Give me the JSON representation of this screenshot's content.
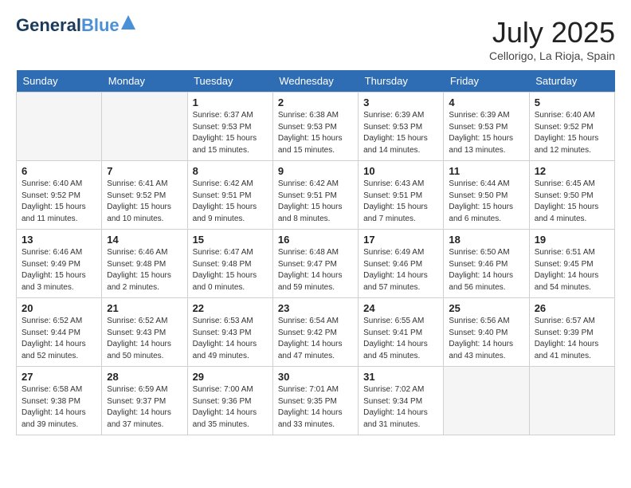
{
  "header": {
    "logo_line1": "General",
    "logo_line2": "Blue",
    "month_title": "July 2025",
    "location": "Cellorigo, La Rioja, Spain"
  },
  "weekdays": [
    "Sunday",
    "Monday",
    "Tuesday",
    "Wednesday",
    "Thursday",
    "Friday",
    "Saturday"
  ],
  "weeks": [
    [
      {
        "day": "",
        "empty": true
      },
      {
        "day": "",
        "empty": true
      },
      {
        "day": "1",
        "sunrise": "6:37 AM",
        "sunset": "9:53 PM",
        "daylight": "15 hours and 15 minutes."
      },
      {
        "day": "2",
        "sunrise": "6:38 AM",
        "sunset": "9:53 PM",
        "daylight": "15 hours and 15 minutes."
      },
      {
        "day": "3",
        "sunrise": "6:39 AM",
        "sunset": "9:53 PM",
        "daylight": "15 hours and 14 minutes."
      },
      {
        "day": "4",
        "sunrise": "6:39 AM",
        "sunset": "9:53 PM",
        "daylight": "15 hours and 13 minutes."
      },
      {
        "day": "5",
        "sunrise": "6:40 AM",
        "sunset": "9:52 PM",
        "daylight": "15 hours and 12 minutes."
      }
    ],
    [
      {
        "day": "6",
        "sunrise": "6:40 AM",
        "sunset": "9:52 PM",
        "daylight": "15 hours and 11 minutes."
      },
      {
        "day": "7",
        "sunrise": "6:41 AM",
        "sunset": "9:52 PM",
        "daylight": "15 hours and 10 minutes."
      },
      {
        "day": "8",
        "sunrise": "6:42 AM",
        "sunset": "9:51 PM",
        "daylight": "15 hours and 9 minutes."
      },
      {
        "day": "9",
        "sunrise": "6:42 AM",
        "sunset": "9:51 PM",
        "daylight": "15 hours and 8 minutes."
      },
      {
        "day": "10",
        "sunrise": "6:43 AM",
        "sunset": "9:51 PM",
        "daylight": "15 hours and 7 minutes."
      },
      {
        "day": "11",
        "sunrise": "6:44 AM",
        "sunset": "9:50 PM",
        "daylight": "15 hours and 6 minutes."
      },
      {
        "day": "12",
        "sunrise": "6:45 AM",
        "sunset": "9:50 PM",
        "daylight": "15 hours and 4 minutes."
      }
    ],
    [
      {
        "day": "13",
        "sunrise": "6:46 AM",
        "sunset": "9:49 PM",
        "daylight": "15 hours and 3 minutes."
      },
      {
        "day": "14",
        "sunrise": "6:46 AM",
        "sunset": "9:48 PM",
        "daylight": "15 hours and 2 minutes."
      },
      {
        "day": "15",
        "sunrise": "6:47 AM",
        "sunset": "9:48 PM",
        "daylight": "15 hours and 0 minutes."
      },
      {
        "day": "16",
        "sunrise": "6:48 AM",
        "sunset": "9:47 PM",
        "daylight": "14 hours and 59 minutes."
      },
      {
        "day": "17",
        "sunrise": "6:49 AM",
        "sunset": "9:46 PM",
        "daylight": "14 hours and 57 minutes."
      },
      {
        "day": "18",
        "sunrise": "6:50 AM",
        "sunset": "9:46 PM",
        "daylight": "14 hours and 56 minutes."
      },
      {
        "day": "19",
        "sunrise": "6:51 AM",
        "sunset": "9:45 PM",
        "daylight": "14 hours and 54 minutes."
      }
    ],
    [
      {
        "day": "20",
        "sunrise": "6:52 AM",
        "sunset": "9:44 PM",
        "daylight": "14 hours and 52 minutes."
      },
      {
        "day": "21",
        "sunrise": "6:52 AM",
        "sunset": "9:43 PM",
        "daylight": "14 hours and 50 minutes."
      },
      {
        "day": "22",
        "sunrise": "6:53 AM",
        "sunset": "9:43 PM",
        "daylight": "14 hours and 49 minutes."
      },
      {
        "day": "23",
        "sunrise": "6:54 AM",
        "sunset": "9:42 PM",
        "daylight": "14 hours and 47 minutes."
      },
      {
        "day": "24",
        "sunrise": "6:55 AM",
        "sunset": "9:41 PM",
        "daylight": "14 hours and 45 minutes."
      },
      {
        "day": "25",
        "sunrise": "6:56 AM",
        "sunset": "9:40 PM",
        "daylight": "14 hours and 43 minutes."
      },
      {
        "day": "26",
        "sunrise": "6:57 AM",
        "sunset": "9:39 PM",
        "daylight": "14 hours and 41 minutes."
      }
    ],
    [
      {
        "day": "27",
        "sunrise": "6:58 AM",
        "sunset": "9:38 PM",
        "daylight": "14 hours and 39 minutes."
      },
      {
        "day": "28",
        "sunrise": "6:59 AM",
        "sunset": "9:37 PM",
        "daylight": "14 hours and 37 minutes."
      },
      {
        "day": "29",
        "sunrise": "7:00 AM",
        "sunset": "9:36 PM",
        "daylight": "14 hours and 35 minutes."
      },
      {
        "day": "30",
        "sunrise": "7:01 AM",
        "sunset": "9:35 PM",
        "daylight": "14 hours and 33 minutes."
      },
      {
        "day": "31",
        "sunrise": "7:02 AM",
        "sunset": "9:34 PM",
        "daylight": "14 hours and 31 minutes."
      },
      {
        "day": "",
        "empty": true
      },
      {
        "day": "",
        "empty": true
      }
    ]
  ]
}
